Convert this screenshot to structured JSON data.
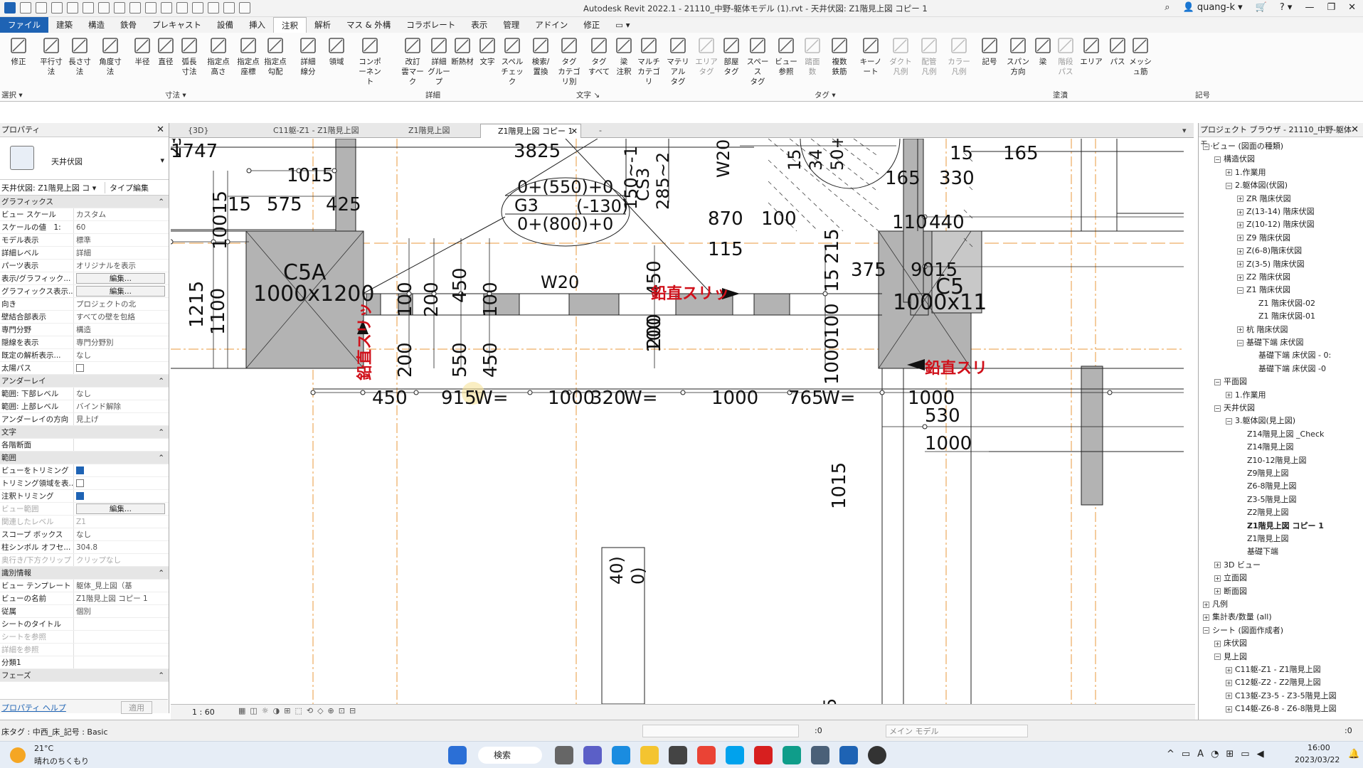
{
  "title_bar": {
    "title": "Autodesk Revit 2022.1 - 21110_中野-躯体モデル (1).rvt - 天井伏図: Z1階見上図 コピー 1",
    "user": "quang-k"
  },
  "menu_tabs": [
    "ファイル",
    "建築",
    "構造",
    "鉄骨",
    "プレキャスト",
    "設備",
    "挿入",
    "注釈",
    "解析",
    "マス & 外構",
    "コラボレート",
    "表示",
    "管理",
    "アドイン",
    "修正"
  ],
  "ribbon": {
    "buttons": [
      {
        "label": "修正",
        "icon": "arrow-pointer-icon"
      },
      {
        "label": "平行寸法",
        "icon": "aligned-dimension-icon"
      },
      {
        "label": "長さ寸法",
        "icon": "linear-dimension-icon"
      },
      {
        "label": "角度寸法",
        "icon": "angular-dimension-icon"
      },
      {
        "label": "半径",
        "icon": "radial-dimension-icon"
      },
      {
        "label": "直径",
        "icon": "diameter-dimension-icon"
      },
      {
        "label": "弧長\n寸法",
        "icon": "arc-length-icon"
      },
      {
        "label": "指定点\n高さ",
        "icon": "spot-elevation-icon"
      },
      {
        "label": "指定点\n座標",
        "icon": "spot-coordinate-icon"
      },
      {
        "label": "指定点\n勾配",
        "icon": "spot-slope-icon"
      },
      {
        "label": "詳細\n線分",
        "icon": "detail-line-icon"
      },
      {
        "label": "領域",
        "icon": "region-icon"
      },
      {
        "label": "コンポーネント",
        "icon": "component-icon"
      },
      {
        "label": "改訂\n雲マーク",
        "icon": "revision-cloud-icon"
      },
      {
        "label": "詳細\nグループ",
        "icon": "detail-group-icon"
      },
      {
        "label": "断熱材",
        "icon": "insulation-icon"
      },
      {
        "label": "文字",
        "icon": "text-icon"
      },
      {
        "label": "スペル\nチェック",
        "icon": "spell-check-icon"
      },
      {
        "label": "検索/\n置換",
        "icon": "find-replace-icon"
      },
      {
        "label": "タグ\nカテゴリ別",
        "icon": "tag-by-category-icon"
      },
      {
        "label": "タグ\nすべて",
        "icon": "tag-all-icon"
      },
      {
        "label": "梁\n注釈",
        "icon": "beam-annotation-icon"
      },
      {
        "label": "マルチ\nカテゴリ",
        "icon": "multi-category-icon"
      },
      {
        "label": "マテリアル\nタグ",
        "icon": "material-tag-icon"
      },
      {
        "label": "エリア\nタグ",
        "icon": "area-tag-icon",
        "disabled": true
      },
      {
        "label": "部屋\nタグ",
        "icon": "room-tag-icon"
      },
      {
        "label": "スペース\nタグ",
        "icon": "space-tag-icon"
      },
      {
        "label": "ビュー\n参照",
        "icon": "view-reference-icon"
      },
      {
        "label": "踏面\n数",
        "icon": "tread-number-icon",
        "disabled": true
      },
      {
        "label": "複数\n鉄筋",
        "icon": "multi-rebar-icon"
      },
      {
        "label": "キーノート",
        "icon": "keynote-icon"
      },
      {
        "label": "ダクト\n凡例",
        "icon": "duct-legend-icon",
        "disabled": true
      },
      {
        "label": "配管\n凡例",
        "icon": "pipe-legend-icon",
        "disabled": true
      },
      {
        "label": "カラー\n凡例",
        "icon": "color-legend-icon",
        "disabled": true
      },
      {
        "label": "記号",
        "icon": "symbol-icon"
      },
      {
        "label": "スパン\n方向",
        "icon": "span-direction-icon"
      },
      {
        "label": "梁",
        "icon": "beam-icon"
      },
      {
        "label": "階段\nパス",
        "icon": "stair-path-icon",
        "disabled": true
      },
      {
        "label": "エリア",
        "icon": "area-icon"
      },
      {
        "label": "パス",
        "icon": "path-icon"
      },
      {
        "label": "メッシュ筋",
        "icon": "fabric-icon"
      }
    ],
    "groups": [
      "選択 ▾",
      "寸法 ▾",
      "詳細",
      "文字 ↘",
      "タグ ▾",
      "塗潰",
      "記号"
    ]
  },
  "properties": {
    "header": "プロパティ",
    "type_name": "天井伏図",
    "view_selector": "天井伏図: Z1階見上図 コ",
    "edit_type": "タイプ編集",
    "rows": [
      {
        "k": "グラフィックス",
        "v": "",
        "sec": true
      },
      {
        "k": "ビュー スケール",
        "v": "カスタム"
      },
      {
        "k": "スケールの値　1:",
        "v": "60"
      },
      {
        "k": "モデル表示",
        "v": "標準"
      },
      {
        "k": "詳細レベル",
        "v": "詳細"
      },
      {
        "k": "パーツ表示",
        "v": "オリジナルを表示"
      },
      {
        "k": "表示/グラフィック...",
        "v": "編集...",
        "btn": true
      },
      {
        "k": "グラフィックス表示...",
        "v": "編集...",
        "btn": true
      },
      {
        "k": "向き",
        "v": "プロジェクトの北"
      },
      {
        "k": "壁結合部表示",
        "v": "すべての壁を包絡"
      },
      {
        "k": "専門分野",
        "v": "構造"
      },
      {
        "k": "隠線を表示",
        "v": "専門分野別"
      },
      {
        "k": "既定の解析表示...",
        "v": "なし"
      },
      {
        "k": "太陽パス",
        "v": "",
        "chk": false
      },
      {
        "k": "アンダーレイ",
        "v": "",
        "sec": true
      },
      {
        "k": "範囲: 下部レベル",
        "v": "なし"
      },
      {
        "k": "範囲: 上部レベル",
        "v": "バインド解除"
      },
      {
        "k": "アンダーレイの方向",
        "v": "見上げ"
      },
      {
        "k": "文字",
        "v": "",
        "sec": true
      },
      {
        "k": "各階断面",
        "v": ""
      },
      {
        "k": "範囲",
        "v": "",
        "sec": true
      },
      {
        "k": "ビューをトリミング",
        "v": "",
        "chk": true
      },
      {
        "k": "トリミング領域を表...",
        "v": "",
        "chk": false
      },
      {
        "k": "注釈トリミング",
        "v": "",
        "chk": true
      },
      {
        "k": "ビュー範囲",
        "v": "編集...",
        "btn": true,
        "dim": true
      },
      {
        "k": "関連したレベル",
        "v": "Z1",
        "dim": true
      },
      {
        "k": "スコープ ボックス",
        "v": "なし"
      },
      {
        "k": "柱シンボル オフセ...",
        "v": "304.8"
      },
      {
        "k": "奥行き/下方クリップ",
        "v": "クリップなし",
        "dim": true
      },
      {
        "k": "識別情報",
        "v": "",
        "sec": true
      },
      {
        "k": "ビュー テンプレート",
        "v": "躯体_見上図（基"
      },
      {
        "k": "ビューの名前",
        "v": "Z1階見上図 コピー 1"
      },
      {
        "k": "従属",
        "v": "個別"
      },
      {
        "k": "シートのタイトル",
        "v": ""
      },
      {
        "k": "シートを参照",
        "v": "",
        "dim": true
      },
      {
        "k": "詳細を参照",
        "v": "",
        "dim": true
      },
      {
        "k": "分類1",
        "v": ""
      },
      {
        "k": "フェーズ",
        "v": "",
        "sec": true
      }
    ],
    "help": "プロパティ ヘルプ",
    "apply": "適用"
  },
  "view_tabs": [
    {
      "label": "{3D}",
      "active": false
    },
    {
      "label": "C11躯-Z1 - Z1階見上図",
      "active": false
    },
    {
      "label": "Z1階見上図",
      "active": false
    },
    {
      "label": "Z1階見上図 コピー 1",
      "active": true
    },
    {
      "label": "-",
      "active": false
    }
  ],
  "drawing": {
    "dims": [
      "3825",
      "1015",
      "15",
      "575",
      "425",
      "100",
      "15",
      "1215",
      "1100",
      "100",
      "200",
      "450",
      "100",
      "200",
      "550",
      "450",
      "100",
      "450",
      "200",
      "450",
      "915",
      "W=",
      "1000",
      "320",
      "W=",
      "1000",
      "765",
      "W=",
      "870",
      "100",
      "115",
      "215",
      "15",
      "100",
      "1000",
      "15",
      "165",
      "165",
      "330",
      "110",
      "440",
      "375",
      "9015",
      "1000",
      "530",
      "1000",
      "1015",
      "1747"
    ],
    "labels": {
      "c5a": "C5A",
      "c5a_size": "1000x1200",
      "c5": "C5",
      "c5_size": "1000x11",
      "w20a": "W20",
      "w20b": "W20",
      "g3": "G3",
      "g3_top": "0+(550)+0",
      "g3_bot": "0+(800)+0",
      "g3_off": "(-130)",
      "cs3": "CS3",
      "cs3a": "150~-1",
      "cs3b": "285~2",
      "slit": "鉛直スリッ",
      "slit_v": "鉛直スリッ",
      "slit_r": "鉛直スリ",
      "tl": "23",
      "tr1": "15",
      "tr2": "34",
      "tr3": "50+",
      "bl1": "40)",
      "bl2": "0)",
      "bl3": "5",
      "tick": "1"
    }
  },
  "vcb": {
    "scale": "1 : 60"
  },
  "browser": {
    "header": "プロジェクト ブラウザ - 21110_中野-躯体モ...",
    "items": [
      {
        "t": "ビュー (図面の種類)",
        "l": 1,
        "e": "−"
      },
      {
        "t": "構造伏図",
        "l": 2,
        "e": "−"
      },
      {
        "t": "1.作業用",
        "l": 3,
        "e": "+"
      },
      {
        "t": "2.躯体図(伏図)",
        "l": 3,
        "e": "−"
      },
      {
        "t": "ZR 階床伏図",
        "l": 4,
        "e": "+"
      },
      {
        "t": "Z(13-14) 階床伏図",
        "l": 4,
        "e": "+"
      },
      {
        "t": "Z(10-12) 階床伏図",
        "l": 4,
        "e": "+"
      },
      {
        "t": "Z9 階床伏図",
        "l": 4,
        "e": "+"
      },
      {
        "t": "Z(6-8)階床伏図",
        "l": 4,
        "e": "+"
      },
      {
        "t": "Z(3-5) 階床伏図",
        "l": 4,
        "e": "+"
      },
      {
        "t": "Z2 階床伏図",
        "l": 4,
        "e": "+"
      },
      {
        "t": "Z1 階床伏図",
        "l": 4,
        "e": "−"
      },
      {
        "t": "Z1 階床伏図-02",
        "l": 5,
        "e": ""
      },
      {
        "t": "Z1 階床伏図-01",
        "l": 5,
        "e": ""
      },
      {
        "t": "杭 階床伏図",
        "l": 4,
        "e": "+"
      },
      {
        "t": "基礎下端 床伏図",
        "l": 4,
        "e": "−"
      },
      {
        "t": "基礎下端 床伏図 - 0:",
        "l": 5,
        "e": ""
      },
      {
        "t": "基礎下端 床伏図 -0",
        "l": 5,
        "e": ""
      },
      {
        "t": "平面図",
        "l": 2,
        "e": "−"
      },
      {
        "t": "1.作業用",
        "l": 3,
        "e": "+"
      },
      {
        "t": "天井伏図",
        "l": 2,
        "e": "−"
      },
      {
        "t": "3.躯体図(見上図)",
        "l": 3,
        "e": "−"
      },
      {
        "t": "Z14階見上図 _Check",
        "l": 4,
        "e": ""
      },
      {
        "t": "Z14階見上図",
        "l": 4,
        "e": ""
      },
      {
        "t": "Z10-12階見上図",
        "l": 4,
        "e": ""
      },
      {
        "t": "Z9階見上図",
        "l": 4,
        "e": ""
      },
      {
        "t": "Z6-8階見上図",
        "l": 4,
        "e": ""
      },
      {
        "t": "Z3-5階見上図",
        "l": 4,
        "e": ""
      },
      {
        "t": "Z2階見上図",
        "l": 4,
        "e": ""
      },
      {
        "t": "Z1階見上図 コピー 1",
        "l": 4,
        "e": "",
        "bold": true
      },
      {
        "t": "Z1階見上図",
        "l": 4,
        "e": ""
      },
      {
        "t": "基礎下端",
        "l": 4,
        "e": ""
      },
      {
        "t": "3D ビュー",
        "l": 2,
        "e": "+"
      },
      {
        "t": "立面図",
        "l": 2,
        "e": "+"
      },
      {
        "t": "断面図",
        "l": 2,
        "e": "+"
      },
      {
        "t": "凡例",
        "l": 1,
        "e": "+"
      },
      {
        "t": "集計表/数量 (all)",
        "l": 1,
        "e": "+"
      },
      {
        "t": "シート (図面作成者)",
        "l": 1,
        "e": "−"
      },
      {
        "t": "床伏図",
        "l": 2,
        "e": "+"
      },
      {
        "t": "見上図",
        "l": 2,
        "e": "−"
      },
      {
        "t": "C11躯-Z1 - Z1階見上図",
        "l": 3,
        "e": "+"
      },
      {
        "t": "C12躯-Z2 - Z2階見上図",
        "l": 3,
        "e": "+"
      },
      {
        "t": "C13躯-Z3-5 - Z3-5階見上図",
        "l": 3,
        "e": "+"
      },
      {
        "t": "C14躯-Z6-8 - Z6-8階見上図",
        "l": 3,
        "e": "+"
      }
    ]
  },
  "status": {
    "text": "床タグ : 中西_床_記号 : Basic",
    "coord": ":0",
    "model": "メイン モデル",
    "filter": ":0"
  },
  "taskbar": {
    "temp": "21°C",
    "weather": "晴れのちくもり",
    "search": "検索",
    "time": "16:00",
    "date": "2023/03/22"
  }
}
